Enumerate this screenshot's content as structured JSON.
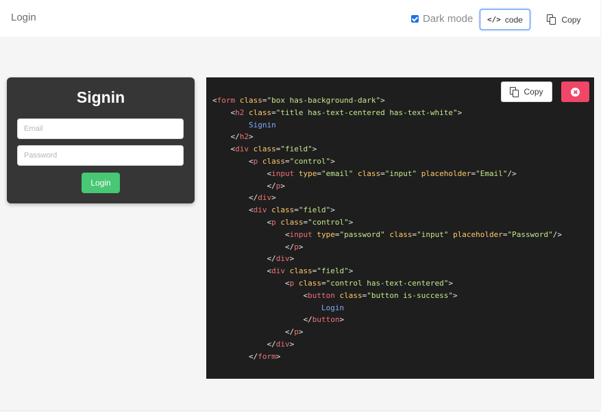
{
  "topbar": {
    "title": "Login",
    "dark_mode_label": "Dark mode",
    "dark_mode_checked": true,
    "code_button_label": "code",
    "copy_button_label": "Copy"
  },
  "preview": {
    "title": "Signin",
    "email_placeholder": "Email",
    "password_placeholder": "Password",
    "login_label": "Login"
  },
  "code_panel": {
    "copy_label": "Copy",
    "close_icon": "close-circle-icon",
    "lines": [
      [
        [
          "p",
          "<"
        ],
        [
          "tag",
          "form"
        ],
        [
          "p",
          " "
        ],
        [
          "attr",
          "class"
        ],
        [
          "p",
          "="
        ],
        [
          "str",
          "\"box has-background-dark\""
        ],
        [
          "p",
          ">"
        ]
      ],
      [
        [
          "p",
          "    <"
        ],
        [
          "tag",
          "h2"
        ],
        [
          "p",
          " "
        ],
        [
          "attr",
          "class"
        ],
        [
          "p",
          "="
        ],
        [
          "str",
          "\"title has-text-centered has-text-white\""
        ],
        [
          "p",
          ">"
        ]
      ],
      [
        [
          "p",
          "        "
        ],
        [
          "text",
          "Signin"
        ]
      ],
      [
        [
          "p",
          "    </"
        ],
        [
          "tag",
          "h2"
        ],
        [
          "p",
          ">"
        ]
      ],
      [
        [
          "p",
          "    <"
        ],
        [
          "tag",
          "div"
        ],
        [
          "p",
          " "
        ],
        [
          "attr",
          "class"
        ],
        [
          "p",
          "="
        ],
        [
          "str",
          "\"field\""
        ],
        [
          "p",
          ">"
        ]
      ],
      [
        [
          "p",
          "        <"
        ],
        [
          "tag",
          "p"
        ],
        [
          "p",
          " "
        ],
        [
          "attr",
          "class"
        ],
        [
          "p",
          "="
        ],
        [
          "str",
          "\"control\""
        ],
        [
          "p",
          ">"
        ]
      ],
      [
        [
          "p",
          "            <"
        ],
        [
          "tag",
          "input"
        ],
        [
          "p",
          " "
        ],
        [
          "attr",
          "type"
        ],
        [
          "p",
          "="
        ],
        [
          "str",
          "\"email\""
        ],
        [
          "p",
          " "
        ],
        [
          "attr",
          "class"
        ],
        [
          "p",
          "="
        ],
        [
          "str",
          "\"input\""
        ],
        [
          "p",
          " "
        ],
        [
          "attr",
          "placeholder"
        ],
        [
          "p",
          "="
        ],
        [
          "str",
          "\"Email\""
        ],
        [
          "p",
          "/>"
        ]
      ],
      [
        [
          "p",
          "            </"
        ],
        [
          "tag",
          "p"
        ],
        [
          "p",
          ">"
        ]
      ],
      [
        [
          "p",
          "        </"
        ],
        [
          "tag",
          "div"
        ],
        [
          "p",
          ">"
        ]
      ],
      [
        [
          "p",
          "        <"
        ],
        [
          "tag",
          "div"
        ],
        [
          "p",
          " "
        ],
        [
          "attr",
          "class"
        ],
        [
          "p",
          "="
        ],
        [
          "str",
          "\"field\""
        ],
        [
          "p",
          ">"
        ]
      ],
      [
        [
          "p",
          "            <"
        ],
        [
          "tag",
          "p"
        ],
        [
          "p",
          " "
        ],
        [
          "attr",
          "class"
        ],
        [
          "p",
          "="
        ],
        [
          "str",
          "\"control\""
        ],
        [
          "p",
          ">"
        ]
      ],
      [
        [
          "p",
          "                <"
        ],
        [
          "tag",
          "input"
        ],
        [
          "p",
          " "
        ],
        [
          "attr",
          "type"
        ],
        [
          "p",
          "="
        ],
        [
          "str",
          "\"password\""
        ],
        [
          "p",
          " "
        ],
        [
          "attr",
          "class"
        ],
        [
          "p",
          "="
        ],
        [
          "str",
          "\"input\""
        ],
        [
          "p",
          " "
        ],
        [
          "attr",
          "placeholder"
        ],
        [
          "p",
          "="
        ],
        [
          "str",
          "\"Password\""
        ],
        [
          "p",
          "/>"
        ]
      ],
      [
        [
          "p",
          "                </"
        ],
        [
          "tag",
          "p"
        ],
        [
          "p",
          ">"
        ]
      ],
      [
        [
          "p",
          "            </"
        ],
        [
          "tag",
          "div"
        ],
        [
          "p",
          ">"
        ]
      ],
      [
        [
          "p",
          "            <"
        ],
        [
          "tag",
          "div"
        ],
        [
          "p",
          " "
        ],
        [
          "attr",
          "class"
        ],
        [
          "p",
          "="
        ],
        [
          "str",
          "\"field\""
        ],
        [
          "p",
          ">"
        ]
      ],
      [
        [
          "p",
          "                <"
        ],
        [
          "tag",
          "p"
        ],
        [
          "p",
          " "
        ],
        [
          "attr",
          "class"
        ],
        [
          "p",
          "="
        ],
        [
          "str",
          "\"control has-text-centered\""
        ],
        [
          "p",
          ">"
        ]
      ],
      [
        [
          "p",
          "                    <"
        ],
        [
          "tag",
          "button"
        ],
        [
          "p",
          " "
        ],
        [
          "attr",
          "class"
        ],
        [
          "p",
          "="
        ],
        [
          "str",
          "\"button is-success\""
        ],
        [
          "p",
          ">"
        ]
      ],
      [
        [
          "p",
          "                        "
        ],
        [
          "text",
          "Login"
        ]
      ],
      [
        [
          "p",
          "                    </"
        ],
        [
          "tag",
          "button"
        ],
        [
          "p",
          ">"
        ]
      ],
      [
        [
          "p",
          "                </"
        ],
        [
          "tag",
          "p"
        ],
        [
          "p",
          ">"
        ]
      ],
      [
        [
          "p",
          "            </"
        ],
        [
          "tag",
          "div"
        ],
        [
          "p",
          ">"
        ]
      ],
      [
        [
          "p",
          "        </"
        ],
        [
          "tag",
          "form"
        ],
        [
          "p",
          ">"
        ]
      ]
    ]
  },
  "colors": {
    "accent_blue": "#3b82f6",
    "success_green": "#48c774",
    "danger_red": "#f14668",
    "preview_dark": "#363636",
    "code_bg": "#1e1e1e"
  }
}
